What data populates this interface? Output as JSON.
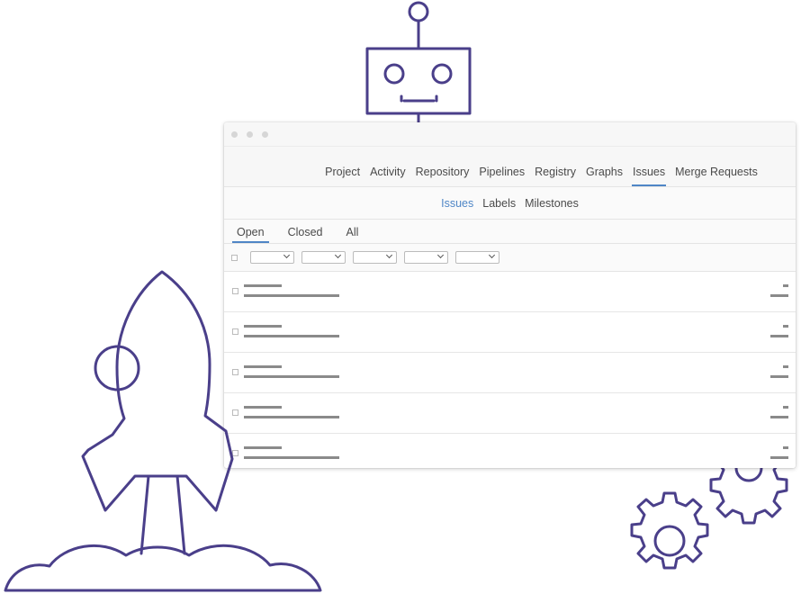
{
  "window": {
    "controls": [
      "close",
      "minimize",
      "maximize"
    ]
  },
  "top_nav": {
    "items": [
      {
        "label": "Project"
      },
      {
        "label": "Activity"
      },
      {
        "label": "Repository"
      },
      {
        "label": "Pipelines"
      },
      {
        "label": "Registry"
      },
      {
        "label": "Graphs"
      },
      {
        "label": "Issues",
        "active": true
      },
      {
        "label": "Merge Requests"
      }
    ]
  },
  "sub_nav": {
    "items": [
      {
        "label": "Issues",
        "active": true
      },
      {
        "label": "Labels"
      },
      {
        "label": "Milestones"
      }
    ]
  },
  "state_tabs": {
    "items": [
      {
        "label": "Open",
        "active": true
      },
      {
        "label": "Closed"
      },
      {
        "label": "All"
      }
    ]
  },
  "filters": {
    "dropdown_count": 5
  },
  "issues": {
    "row_count": 5
  },
  "colors": {
    "accent": "#4f86c6",
    "illustration": "#4a3f8a",
    "text": "#4a4a4a"
  },
  "illustrations": [
    "robot-illustration",
    "rocket-illustration",
    "cloud-illustration",
    "gears-illustration"
  ]
}
